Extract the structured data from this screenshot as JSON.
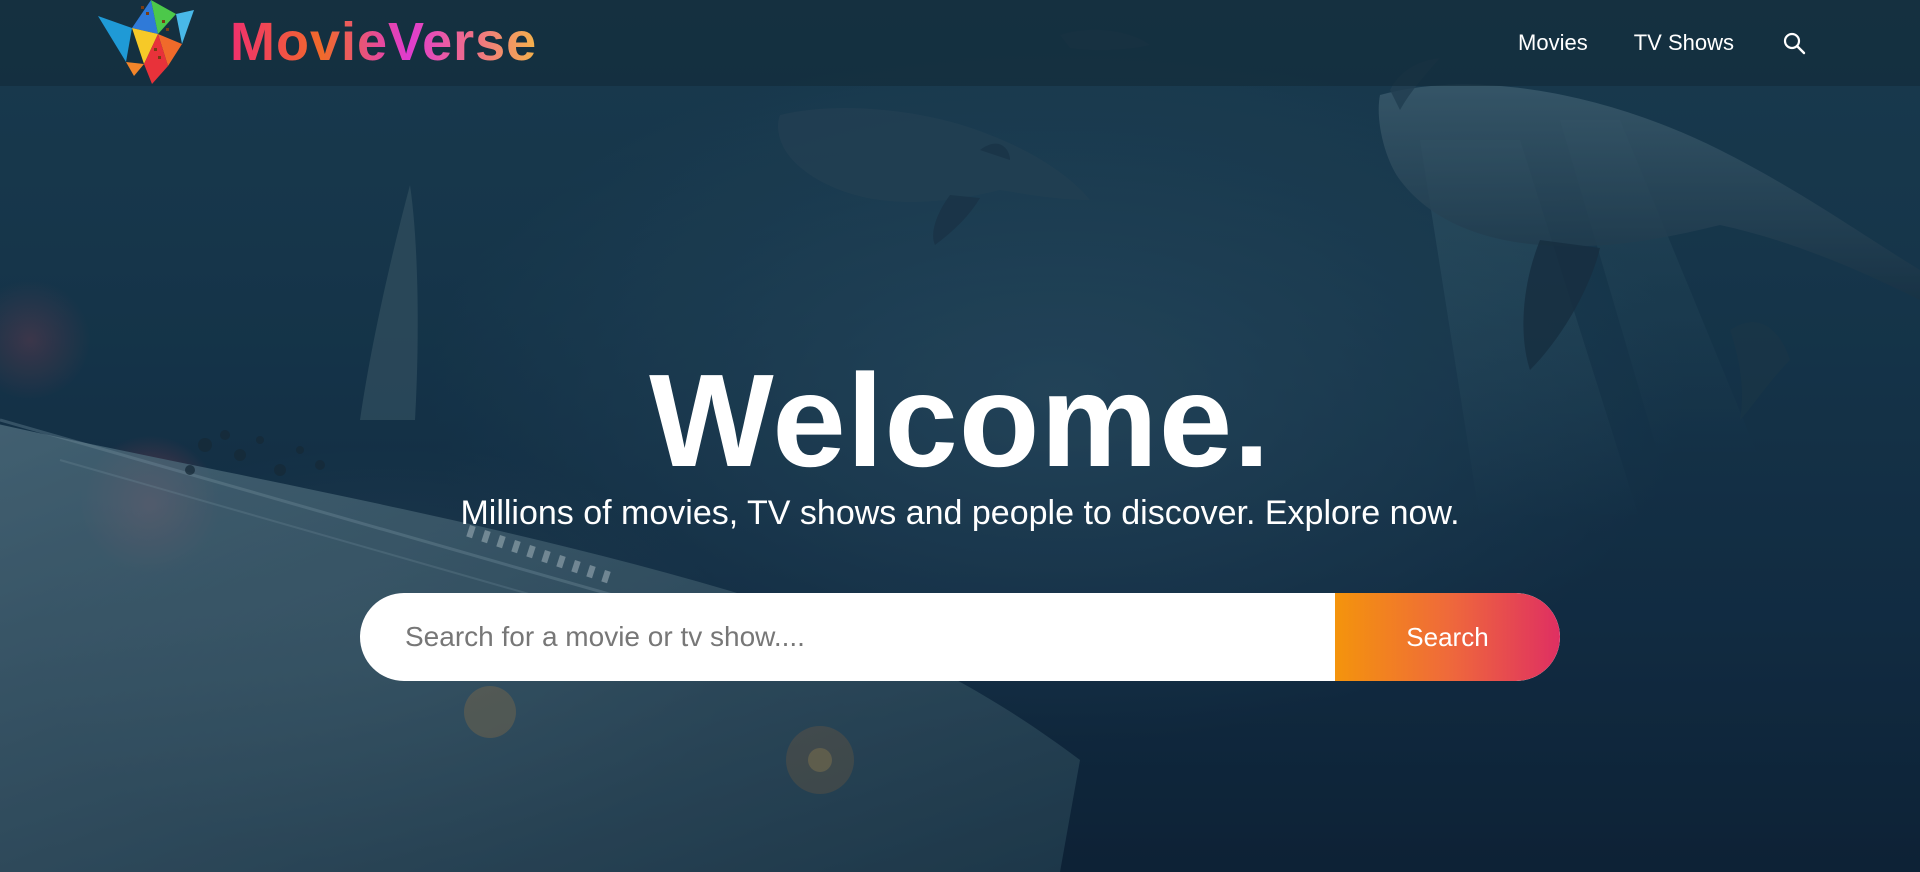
{
  "header": {
    "brand": "MovieVerse",
    "nav": {
      "movies": "Movies",
      "tv_shows": "TV Shows"
    },
    "search_icon": "search-icon"
  },
  "hero": {
    "title": "Welcome.",
    "subtitle": "Millions of movies, TV shows and people to discover. Explore now."
  },
  "search": {
    "placeholder": "Search for a movie or tv show....",
    "value": "",
    "button_label": "Search"
  },
  "colors": {
    "accent_start": "#f4940c",
    "accent_end": "#df2f62"
  }
}
